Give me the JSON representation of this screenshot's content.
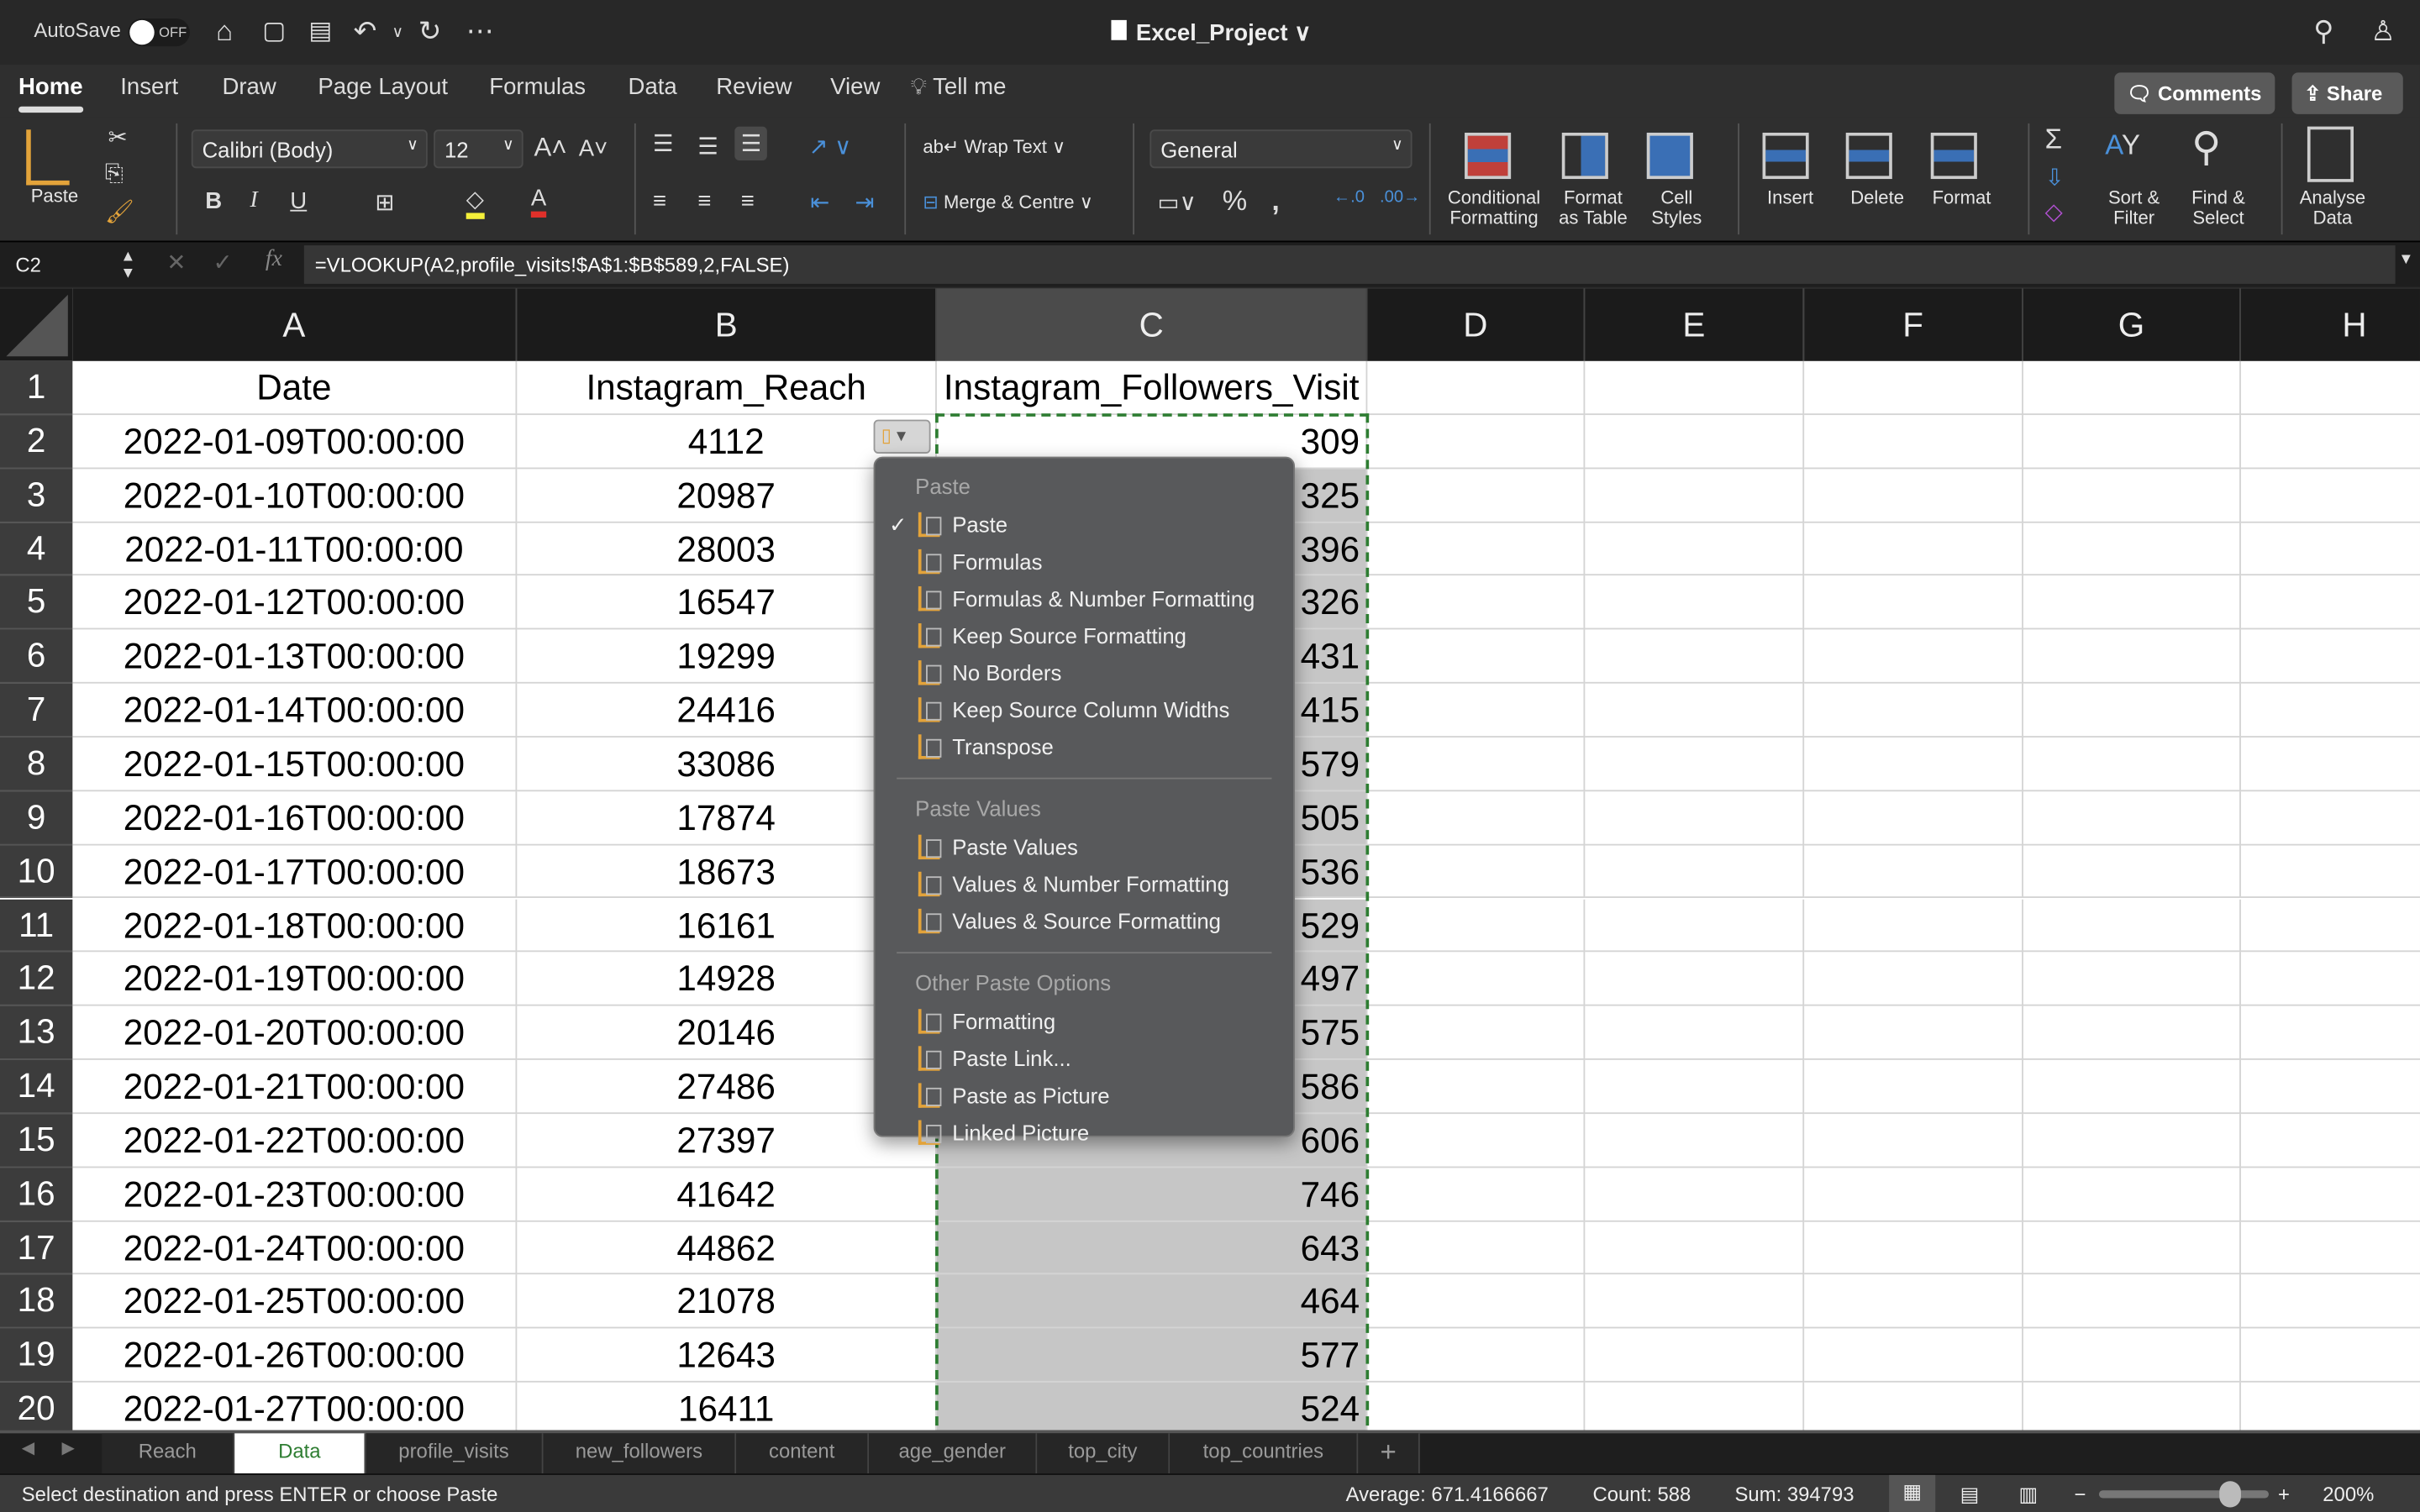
{
  "titlebar": {
    "autosave_label": "AutoSave",
    "autosave_state": "OFF",
    "document_title": "Excel_Project",
    "icons": [
      "home-icon",
      "save-icon",
      "save-as-icon",
      "undo-icon",
      "redo-icon",
      "more-icon",
      "search-icon",
      "share-people-icon"
    ]
  },
  "tabs": [
    "Home",
    "Insert",
    "Draw",
    "Page Layout",
    "Formulas",
    "Data",
    "Review",
    "View",
    "Tell me"
  ],
  "active_tab": "Home",
  "comments_label": "Comments",
  "share_label": "Share",
  "ribbon": {
    "paste": "Paste",
    "font_name": "Calibri (Body)",
    "font_size": "12",
    "bold": "B",
    "italic": "I",
    "underline": "U",
    "wrap_text": "Wrap Text",
    "merge_centre": "Merge & Centre",
    "number_format": "General",
    "conditional_formatting": [
      "Conditional",
      "Formatting"
    ],
    "format_as_table": [
      "Format",
      "as Table"
    ],
    "cell_styles": [
      "Cell",
      "Styles"
    ],
    "insert": "Insert",
    "delete": "Delete",
    "format": "Format",
    "sort_filter": [
      "Sort &",
      "Filter"
    ],
    "find_select": [
      "Find &",
      "Select"
    ],
    "analyse_data": [
      "Analyse",
      "Data"
    ],
    "colors": {
      "fill": "#f5f03a",
      "font": "#e0302a"
    }
  },
  "formula_bar": {
    "name_box": "C2",
    "formula": "=VLOOKUP(A2,profile_visits!$A$1:$B$589,2,FALSE)"
  },
  "columns": [
    "A",
    "B",
    "C",
    "D",
    "E",
    "F",
    "G",
    "H"
  ],
  "selected_column": "C",
  "header_row": [
    "Date",
    "Instagram_Reach",
    "Instagram_Followers_Visit"
  ],
  "rows": [
    [
      "2022-01-09T00:00:00",
      "4112",
      "309"
    ],
    [
      "2022-01-10T00:00:00",
      "20987",
      "325"
    ],
    [
      "2022-01-11T00:00:00",
      "28003",
      "396"
    ],
    [
      "2022-01-12T00:00:00",
      "16547",
      "326"
    ],
    [
      "2022-01-13T00:00:00",
      "19299",
      "431"
    ],
    [
      "2022-01-14T00:00:00",
      "24416",
      "415"
    ],
    [
      "2022-01-15T00:00:00",
      "33086",
      "579"
    ],
    [
      "2022-01-16T00:00:00",
      "17874",
      "505"
    ],
    [
      "2022-01-17T00:00:00",
      "18673",
      "536"
    ],
    [
      "2022-01-18T00:00:00",
      "16161",
      "529"
    ],
    [
      "2022-01-19T00:00:00",
      "14928",
      "497"
    ],
    [
      "2022-01-20T00:00:00",
      "20146",
      "575"
    ],
    [
      "2022-01-21T00:00:00",
      "27486",
      "586"
    ],
    [
      "2022-01-22T00:00:00",
      "27397",
      "606"
    ],
    [
      "2022-01-23T00:00:00",
      "41642",
      "746"
    ],
    [
      "2022-01-24T00:00:00",
      "44862",
      "643"
    ],
    [
      "2022-01-25T00:00:00",
      "21078",
      "464"
    ],
    [
      "2022-01-26T00:00:00",
      "12643",
      "577"
    ],
    [
      "2022-01-27T00:00:00",
      "16411",
      "524"
    ]
  ],
  "paste_menu": {
    "sections": [
      {
        "title": "Paste",
        "items": [
          {
            "label": "Paste",
            "checked": true,
            "icon": "paste-icon"
          },
          {
            "label": "Formulas",
            "icon": "paste-formulas-icon"
          },
          {
            "label": "Formulas & Number Formatting",
            "icon": "paste-formulas-number-icon"
          },
          {
            "label": "Keep Source Formatting",
            "icon": "paste-keep-source-icon"
          },
          {
            "label": "No Borders",
            "icon": "paste-no-borders-icon"
          },
          {
            "label": "Keep Source Column Widths",
            "icon": "paste-column-widths-icon"
          },
          {
            "label": "Transpose",
            "icon": "paste-transpose-icon"
          }
        ]
      },
      {
        "title": "Paste Values",
        "items": [
          {
            "label": "Paste Values",
            "icon": "paste-values-icon"
          },
          {
            "label": "Values & Number Formatting",
            "icon": "paste-values-number-icon"
          },
          {
            "label": "Values & Source Formatting",
            "icon": "paste-values-source-icon"
          }
        ]
      },
      {
        "title": "Other Paste Options",
        "items": [
          {
            "label": "Formatting",
            "icon": "paste-formatting-icon"
          },
          {
            "label": "Paste Link...",
            "icon": "paste-link-icon"
          },
          {
            "label": "Paste as Picture",
            "icon": "paste-picture-icon"
          },
          {
            "label": "Linked Picture",
            "icon": "linked-picture-icon"
          }
        ]
      }
    ]
  },
  "sheet_tabs": [
    "Reach",
    "Data",
    "profile_visits",
    "new_followers",
    "content",
    "age_gender",
    "top_city",
    "top_countries"
  ],
  "active_sheet": "Data",
  "status": {
    "message": "Select destination and press ENTER or choose Paste",
    "average": "Average: 671.4166667",
    "count": "Count: 588",
    "sum": "Sum: 394793",
    "zoom": "200%",
    "zoom_percent": 200
  }
}
